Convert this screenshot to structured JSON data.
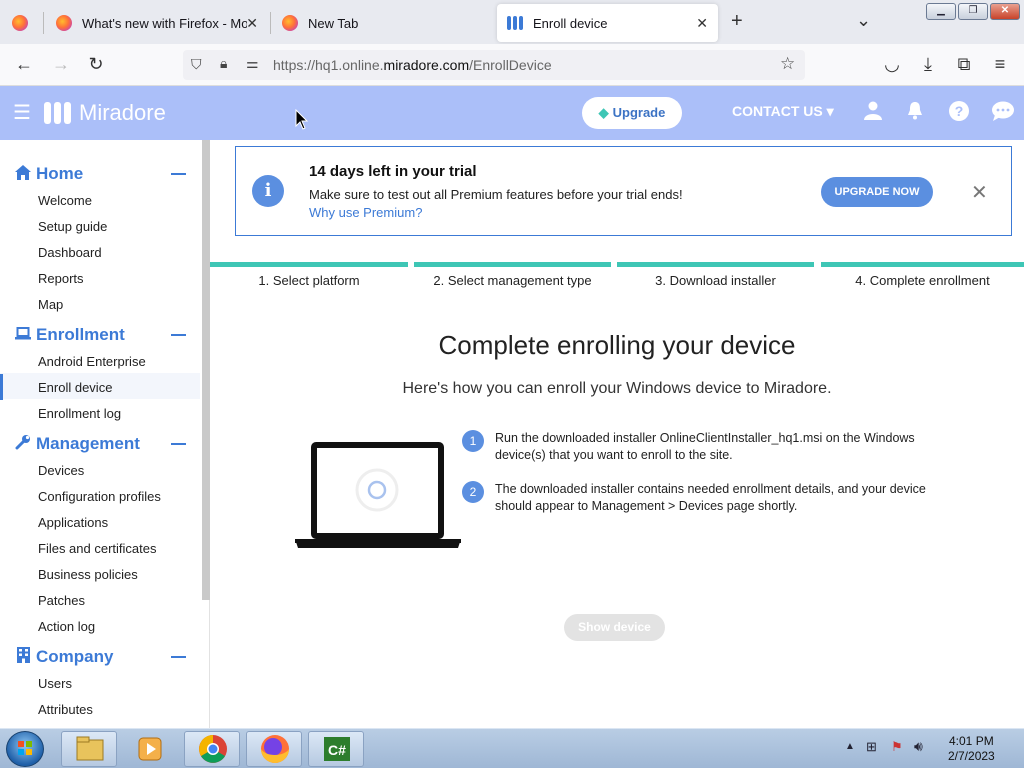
{
  "browser": {
    "tabs": [
      {
        "title": "",
        "pinned": true
      },
      {
        "title": "What's new with Firefox - More"
      },
      {
        "title": "New Tab"
      },
      {
        "title": "Enroll device",
        "active": true
      }
    ],
    "new_tab_symbol": "+",
    "tab_list_symbol": "⌄",
    "url_host_prefix": "https://hq1.online.",
    "url_host": "miradore.com",
    "url_path": "/EnrollDevice"
  },
  "header": {
    "logo_text": "Miradore",
    "upgrade_label": "Upgrade",
    "contact_label": "CONTACT US",
    "contact_caret": "▾"
  },
  "sidebar": {
    "sections": [
      {
        "title": "Home",
        "icon": "home-icon",
        "items": [
          "Welcome",
          "Setup guide",
          "Dashboard",
          "Reports",
          "Map"
        ]
      },
      {
        "title": "Enrollment",
        "icon": "laptop-icon",
        "items": [
          "Android Enterprise",
          "Enroll device",
          "Enrollment log"
        ],
        "selected": "Enroll device"
      },
      {
        "title": "Management",
        "icon": "wrench-icon",
        "items": [
          "Devices",
          "Configuration profiles",
          "Applications",
          "Files and certificates",
          "Business policies",
          "Patches",
          "Action log"
        ]
      },
      {
        "title": "Company",
        "icon": "building-icon",
        "items": [
          "Users",
          "Attributes"
        ]
      }
    ]
  },
  "banner": {
    "title": "14 days left in your trial",
    "description": "Make sure to test out all Premium features before your trial ends!",
    "link": "Why use Premium?",
    "button": "UPGRADE NOW",
    "close": "✕",
    "info_glyph": "i"
  },
  "steps": [
    "1. Select platform",
    "2. Select management type",
    "3. Download installer",
    "4. Complete enrollment"
  ],
  "main": {
    "title": "Complete enrolling your device",
    "subtitle": "Here's how you can enroll your Windows device to Miradore.",
    "instructions": [
      {
        "num": "1",
        "text": "Run the downloaded installer OnlineClientInstaller_hq1.msi on the Windows device(s) that you want to enroll to the site."
      },
      {
        "num": "2",
        "text": "The downloaded installer contains needed enrollment details, and your device should appear to Management > Devices page shortly."
      }
    ],
    "show_device_button": "Show device"
  },
  "taskbar": {
    "time": "4:01 PM",
    "date": "2/7/2023",
    "apps": [
      "explorer-icon",
      "media-player-icon",
      "chrome-icon",
      "firefox-icon",
      "csharp-icon"
    ]
  },
  "colors": {
    "accent": "#3c7ad6",
    "header_bg": "#abbff9",
    "step_bar": "#3ec6b5",
    "button_blue": "#5b8fe0"
  }
}
